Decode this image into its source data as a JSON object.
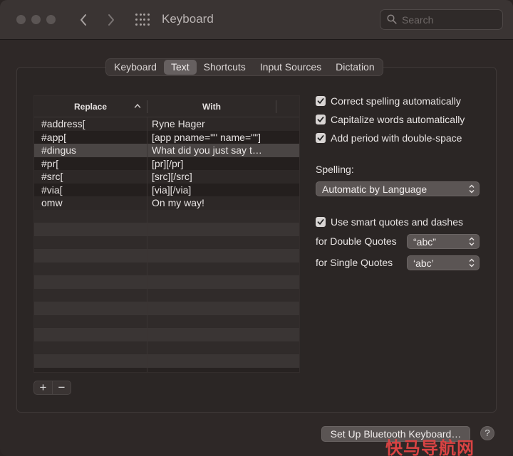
{
  "window": {
    "title": "Keyboard"
  },
  "search": {
    "placeholder": "Search"
  },
  "tabs": [
    {
      "label": "Keyboard",
      "active": false
    },
    {
      "label": "Text",
      "active": true
    },
    {
      "label": "Shortcuts",
      "active": false
    },
    {
      "label": "Input Sources",
      "active": false
    },
    {
      "label": "Dictation",
      "active": false
    }
  ],
  "table": {
    "headers": {
      "replace": "Replace",
      "with": "With"
    },
    "rows": [
      {
        "replace": "#address[",
        "with": "Ryne Hager"
      },
      {
        "replace": "#app[",
        "with": "[app pname=\"\" name=\"\"]"
      },
      {
        "replace": "#dingus",
        "with": "What did you just say t…"
      },
      {
        "replace": "#pr[",
        "with": "[pr][/pr]"
      },
      {
        "replace": "#src[",
        "with": "[src][/src]"
      },
      {
        "replace": "#via[",
        "with": "[via][/via]"
      },
      {
        "replace": "omw",
        "with": "On my way!"
      }
    ],
    "selected_row": 2,
    "add_label": "+",
    "remove_label": "−"
  },
  "options": {
    "correct_spelling": "Correct spelling automatically",
    "capitalize_words": "Capitalize words automatically",
    "add_period": "Add period with double-space",
    "spelling_label": "Spelling:",
    "spelling_value": "Automatic by Language",
    "smart_quotes": "Use smart quotes and dashes",
    "double_quotes_label": "for Double Quotes",
    "double_quotes_value": "“abc”",
    "single_quotes_label": "for Single Quotes",
    "single_quotes_value": "‘abc’"
  },
  "footer": {
    "bluetooth_button": "Set Up Bluetooth Keyboard…",
    "help_label": "?"
  },
  "watermark": {
    "text": "快马导航网"
  },
  "colors": {
    "accent_watermark": "#d94343",
    "checkbox": "#d9d5d4"
  }
}
